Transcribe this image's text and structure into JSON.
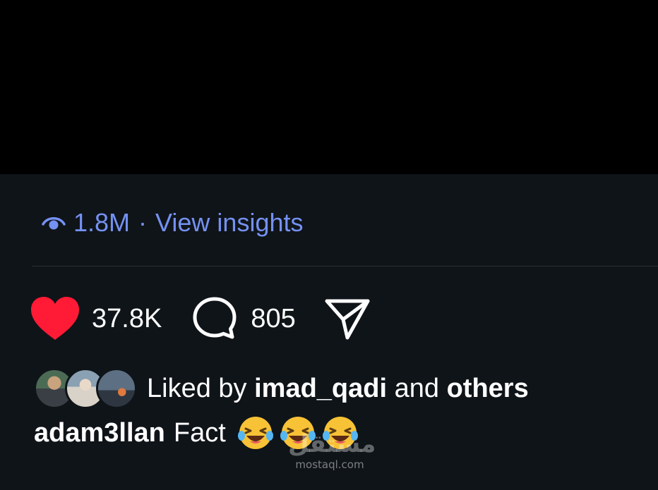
{
  "insights": {
    "views": "1.8M",
    "separator": "·",
    "link_label": "View insights",
    "color": "#7591f2"
  },
  "actions": {
    "like_icon": "heart-icon",
    "like_color": "#ff1a35",
    "likes_count": "37.8K",
    "comment_icon": "comment-icon",
    "comments_count": "805",
    "share_icon": "share-icon"
  },
  "liked_by": {
    "prefix": "Liked by",
    "user": "imad_qadi",
    "joiner": "and",
    "others": "others",
    "avatars": [
      "avatar-1",
      "avatar-2",
      "avatar-3"
    ]
  },
  "caption": {
    "author": "adam3llan",
    "text": "Fact",
    "emojis": [
      "😂",
      "😂",
      "😂"
    ]
  },
  "watermark": {
    "arabic": "مستقل",
    "site": "mostaql.com"
  }
}
